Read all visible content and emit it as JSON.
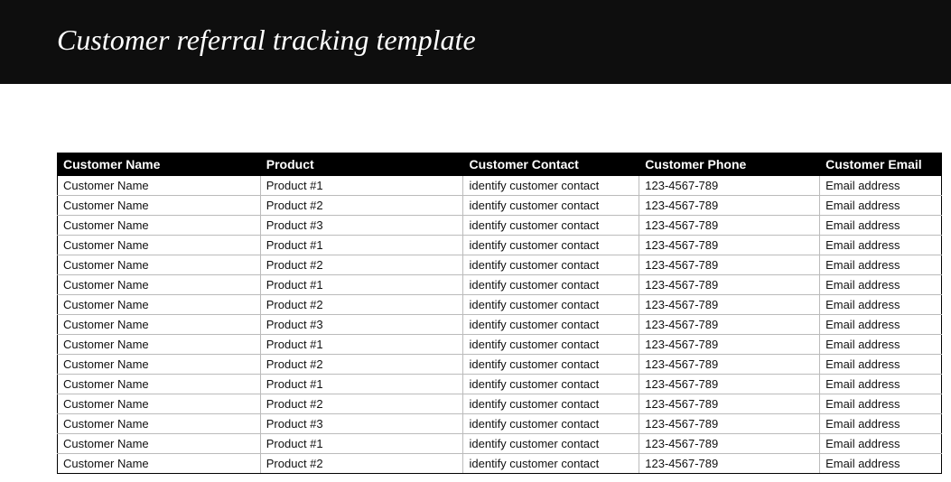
{
  "header": {
    "title": "Customer referral tracking template"
  },
  "table": {
    "columns": [
      "Customer Name",
      "Product",
      "Customer Contact",
      "Customer Phone",
      "Customer Email"
    ],
    "rows": [
      {
        "name": "Customer Name",
        "product": "Product #1",
        "contact": "identify customer contact",
        "phone": "123-4567-789",
        "email": "Email address"
      },
      {
        "name": "Customer Name",
        "product": "Product #2",
        "contact": "identify customer contact",
        "phone": "123-4567-789",
        "email": "Email address"
      },
      {
        "name": "Customer Name",
        "product": "Product #3",
        "contact": "identify customer contact",
        "phone": "123-4567-789",
        "email": "Email address"
      },
      {
        "name": "Customer Name",
        "product": "Product #1",
        "contact": "identify customer contact",
        "phone": "123-4567-789",
        "email": "Email address"
      },
      {
        "name": "Customer Name",
        "product": "Product #2",
        "contact": "identify customer contact",
        "phone": "123-4567-789",
        "email": "Email address"
      },
      {
        "name": "Customer Name",
        "product": "Product #1",
        "contact": "identify customer contact",
        "phone": "123-4567-789",
        "email": "Email address"
      },
      {
        "name": "Customer Name",
        "product": "Product #2",
        "contact": "identify customer contact",
        "phone": "123-4567-789",
        "email": "Email address"
      },
      {
        "name": "Customer Name",
        "product": "Product #3",
        "contact": "identify customer contact",
        "phone": "123-4567-789",
        "email": "Email address"
      },
      {
        "name": "Customer Name",
        "product": "Product #1",
        "contact": "identify customer contact",
        "phone": "123-4567-789",
        "email": "Email address"
      },
      {
        "name": "Customer Name",
        "product": "Product #2",
        "contact": "identify customer contact",
        "phone": "123-4567-789",
        "email": "Email address"
      },
      {
        "name": "Customer Name",
        "product": "Product #1",
        "contact": "identify customer contact",
        "phone": "123-4567-789",
        "email": "Email address"
      },
      {
        "name": "Customer Name",
        "product": "Product #2",
        "contact": "identify customer contact",
        "phone": "123-4567-789",
        "email": "Email address"
      },
      {
        "name": "Customer Name",
        "product": "Product #3",
        "contact": "identify customer contact",
        "phone": "123-4567-789",
        "email": "Email address"
      },
      {
        "name": "Customer Name",
        "product": "Product #1",
        "contact": "identify customer contact",
        "phone": "123-4567-789",
        "email": "Email address"
      },
      {
        "name": "Customer Name",
        "product": "Product #2",
        "contact": "identify customer contact",
        "phone": "123-4567-789",
        "email": "Email address"
      }
    ]
  }
}
